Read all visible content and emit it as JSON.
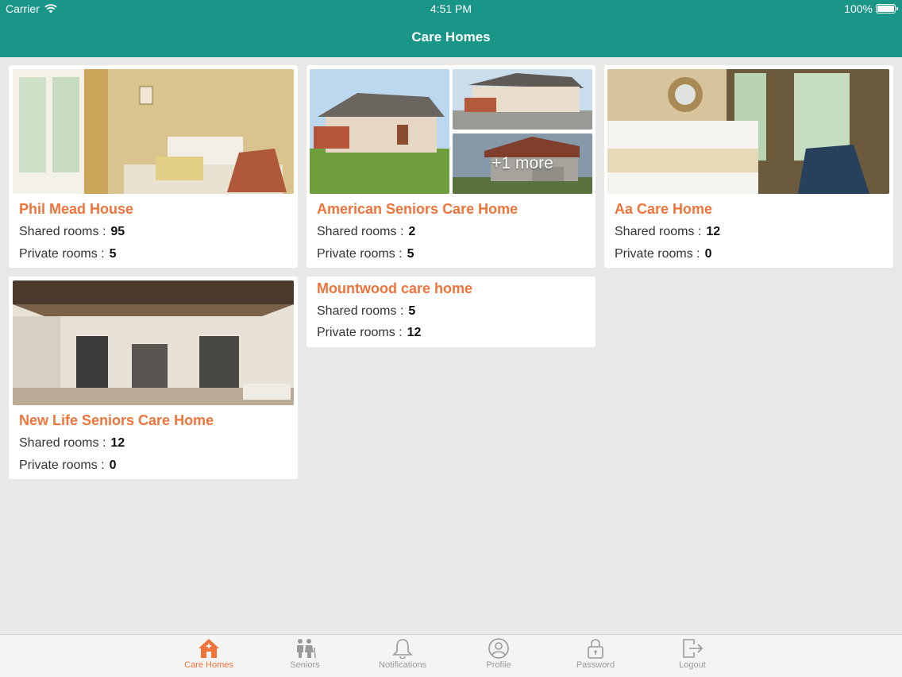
{
  "status_bar": {
    "carrier": "Carrier",
    "time": "4:51 PM",
    "battery": "100%"
  },
  "nav": {
    "title": "Care Homes"
  },
  "cards": [
    {
      "name": "Phil Mead House",
      "shared_label": "Shared rooms :",
      "shared": "95",
      "private_label": "Private rooms :",
      "private": "5"
    },
    {
      "name": "American Seniors Care Home",
      "shared_label": "Shared rooms :",
      "shared": "2",
      "private_label": "Private rooms :",
      "private": "5",
      "more": "+1 more"
    },
    {
      "name": "Aa Care Home",
      "shared_label": "Shared rooms :",
      "shared": "12",
      "private_label": "Private rooms :",
      "private": "0"
    },
    {
      "name": "New Life Seniors Care Home",
      "shared_label": "Shared rooms :",
      "shared": "12",
      "private_label": "Private rooms :",
      "private": "0"
    },
    {
      "name": "Mountwood care home",
      "shared_label": "Shared rooms :",
      "shared": "5",
      "private_label": "Private rooms :",
      "private": "12"
    }
  ],
  "tabs": [
    {
      "label": "Care Homes",
      "icon": "house-icon",
      "active": true
    },
    {
      "label": "Seniors",
      "icon": "seniors-icon"
    },
    {
      "label": "Notifications",
      "icon": "bell-icon"
    },
    {
      "label": "Profile",
      "icon": "user-circle-icon"
    },
    {
      "label": "Password",
      "icon": "lock-icon"
    },
    {
      "label": "Logout",
      "icon": "logout-icon"
    }
  ],
  "colors": {
    "header": "#1a9688",
    "accent": "#f0733a",
    "background": "#e8e9e7"
  }
}
